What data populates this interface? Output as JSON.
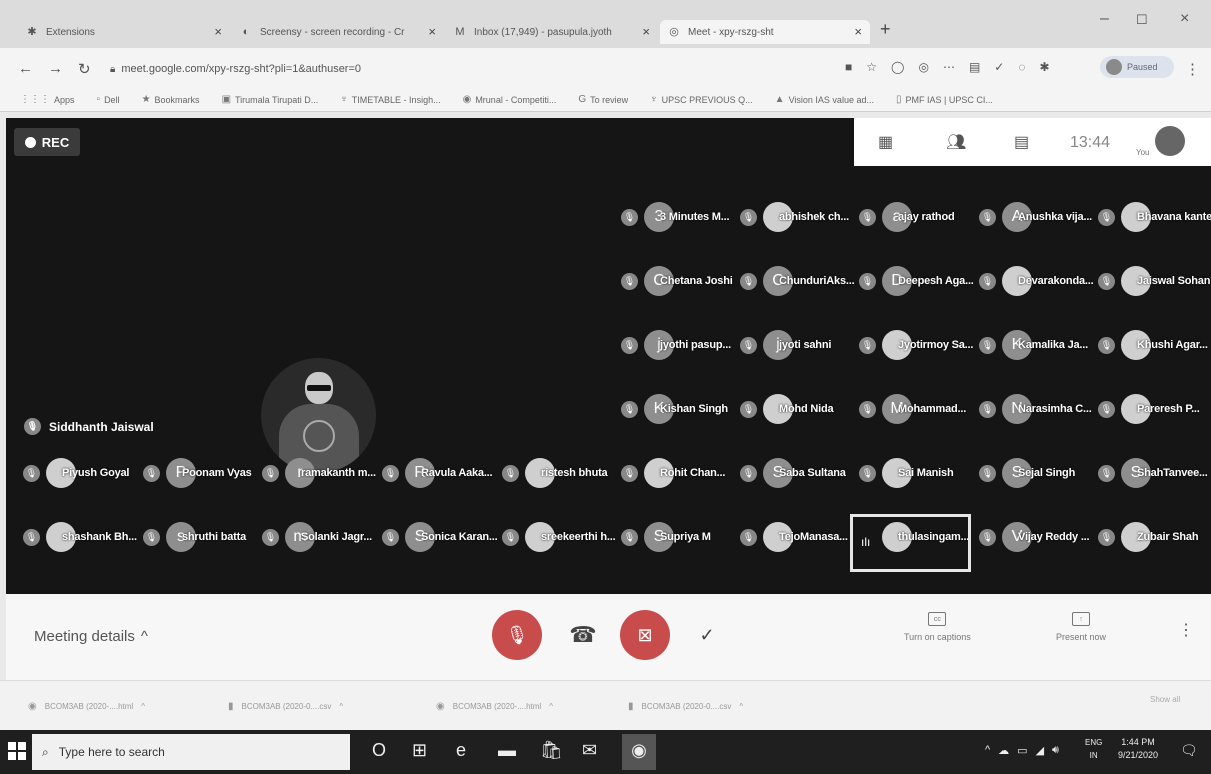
{
  "browser": {
    "tabs": [
      {
        "label": "Extensions",
        "icon": "puzzle-icon"
      },
      {
        "label": "Screensy - screen recording - Cr",
        "icon": "screensy-icon"
      },
      {
        "label": "Inbox (17,949) - pasupula.jyoth",
        "icon": "gmail-icon"
      },
      {
        "label": "Meet - xpy-rszg-sht",
        "icon": "meet-icon"
      }
    ],
    "url": "meet.google.com/xpy-rszg-sht?pli=1&authuser=0",
    "paused_label": "Paused",
    "bookmarks": [
      {
        "label": "Apps",
        "icon": "apps-grid-icon"
      },
      {
        "label": "Dell",
        "icon": "page-icon"
      },
      {
        "label": "Bookmarks",
        "icon": "star-icon"
      },
      {
        "label": "Tirumala Tirupati D...",
        "icon": "site-icon"
      },
      {
        "label": "TIMETABLE - Insigh...",
        "icon": "site-icon"
      },
      {
        "label": "Mrunal - Competiti...",
        "icon": "site-icon"
      },
      {
        "label": "To review",
        "icon": "google-icon"
      },
      {
        "label": "UPSC PREVIOUS Q...",
        "icon": "site-icon"
      },
      {
        "label": "Vision IAS value ad...",
        "icon": "site-icon"
      },
      {
        "label": "PMF IAS | UPSC CI...",
        "icon": "site-icon"
      }
    ]
  },
  "meet": {
    "rec_label": "REC",
    "time": "13:44",
    "you_label": "You",
    "you_initial": "",
    "main_participant": "Siddhanth Jaiswal",
    "participants": [
      {
        "name": "3 Minutes M...",
        "initial": "3",
        "photo": false
      },
      {
        "name": "abhishek ch...",
        "initial": "",
        "photo": true
      },
      {
        "name": "ajay rathod",
        "initial": "a",
        "photo": false
      },
      {
        "name": "Anushka vija...",
        "initial": "A",
        "photo": false
      },
      {
        "name": "Bhavana kante",
        "initial": "",
        "photo": true
      },
      {
        "name": "Chetana Joshi",
        "initial": "C",
        "photo": false
      },
      {
        "name": "ChunduriAks...",
        "initial": "C",
        "photo": false
      },
      {
        "name": "Deepesh Aga...",
        "initial": "D",
        "photo": false
      },
      {
        "name": "Devarakonda...",
        "initial": "",
        "photo": true
      },
      {
        "name": "Jaiswal Sohan",
        "initial": "",
        "photo": true
      },
      {
        "name": "jyothi pasup...",
        "initial": "j",
        "photo": false
      },
      {
        "name": "jyoti sahni",
        "initial": "j",
        "photo": false
      },
      {
        "name": "Jyotirmoy Sa...",
        "initial": "",
        "photo": true
      },
      {
        "name": "Kamalika Ja...",
        "initial": "K",
        "photo": false
      },
      {
        "name": "Khushi Agar...",
        "initial": "",
        "photo": true
      },
      {
        "name": "Kishan Singh",
        "initial": "K",
        "photo": false
      },
      {
        "name": "Mohd Nida",
        "initial": "",
        "photo": true
      },
      {
        "name": "Mohammad...",
        "initial": "M",
        "photo": false
      },
      {
        "name": "Narasimha C...",
        "initial": "N",
        "photo": false
      },
      {
        "name": "Pareresh P...",
        "initial": "",
        "photo": true
      },
      {
        "name": "Piyush Goyal",
        "initial": "",
        "photo": true
      },
      {
        "name": "Poonam Vyas",
        "initial": "P",
        "photo": false
      },
      {
        "name": "ramakanth m...",
        "initial": "r",
        "photo": false
      },
      {
        "name": "Ravula Aaka...",
        "initial": "R",
        "photo": false
      },
      {
        "name": "ristesh bhuta",
        "initial": "",
        "photo": true
      },
      {
        "name": "Rohit Chan...",
        "initial": "",
        "photo": true
      },
      {
        "name": "Saba Sultana",
        "initial": "S",
        "photo": false
      },
      {
        "name": "Sai Manish",
        "initial": "",
        "photo": true
      },
      {
        "name": "Sejal Singh",
        "initial": "S",
        "photo": false
      },
      {
        "name": "ShahTanvee...",
        "initial": "S",
        "photo": false
      },
      {
        "name": "shashank Bh...",
        "initial": "",
        "photo": true
      },
      {
        "name": "shruthi batta",
        "initial": "s",
        "photo": false
      },
      {
        "name": "Solanki Jagr...",
        "initial": "m",
        "photo": false
      },
      {
        "name": "Sonica Karan...",
        "initial": "S",
        "photo": false
      },
      {
        "name": "sreekeerthi h...",
        "initial": "",
        "photo": true
      },
      {
        "name": "Supriya M",
        "initial": "S",
        "photo": false
      },
      {
        "name": "TejoManasa...",
        "initial": "",
        "photo": true
      },
      {
        "name": "thulasingam...",
        "initial": "",
        "photo": true
      },
      {
        "name": "Vijay Reddy ...",
        "initial": "V",
        "photo": false
      },
      {
        "name": "Zubair Shah",
        "initial": "",
        "photo": true
      }
    ],
    "meeting_details_label": "Meeting details",
    "captions_label": "Turn on captions",
    "present_label": "Present now"
  },
  "downloads": {
    "items": [
      "BCOM3AB (2020-....html",
      "BCOM3AB (2020-0....csv",
      "BCOM3AB (2020-....html",
      "BCOM3AB (2020-0....csv"
    ],
    "show_all": "Show all"
  },
  "taskbar": {
    "search_placeholder": "Type here to search",
    "lang_line1": "ENG",
    "lang_line2": "IN",
    "time": "1:44 PM",
    "date": "9/21/2020"
  }
}
